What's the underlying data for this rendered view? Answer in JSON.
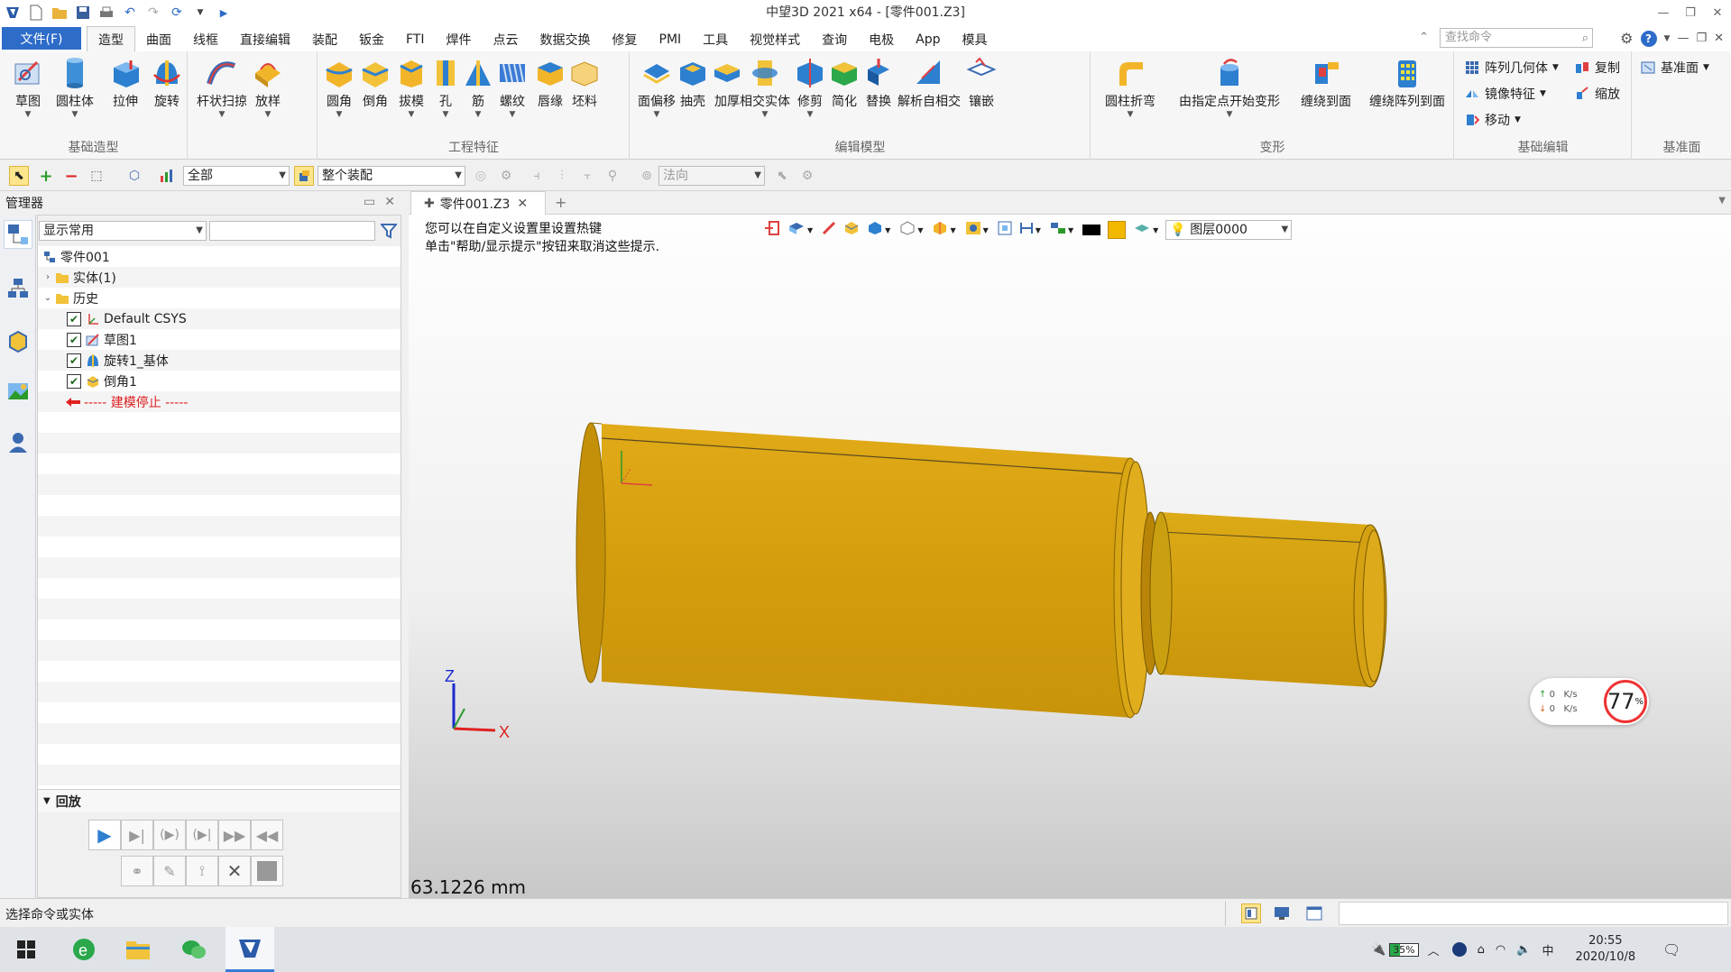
{
  "window": {
    "title": "中望3D 2021 x64 - [零件001.Z3]"
  },
  "menu": {
    "file": "文件(F)",
    "tabs": [
      "造型",
      "曲面",
      "线框",
      "直接编辑",
      "装配",
      "钣金",
      "FTI",
      "焊件",
      "点云",
      "数据交换",
      "修复",
      "PMI",
      "工具",
      "视觉样式",
      "查询",
      "电极",
      "App",
      "模具"
    ],
    "active_index": 0,
    "search_placeholder": "查找命令"
  },
  "ribbon": {
    "groups": [
      {
        "label": "基础造型",
        "buttons": [
          "草图",
          "圆柱体",
          "拉伸",
          "旋转",
          "杆状扫掠",
          "放样"
        ]
      },
      {
        "label": "工程特征",
        "buttons": [
          "圆角",
          "倒角",
          "拔模",
          "孔",
          "筋",
          "螺纹",
          "唇缘",
          "坯料"
        ]
      },
      {
        "label": "编辑模型",
        "buttons": [
          "面偏移",
          "抽壳",
          "加厚",
          "相交实体",
          "修剪",
          "简化",
          "替换",
          "解析自相交",
          "镶嵌"
        ]
      },
      {
        "label": "变形",
        "buttons": [
          "圆柱折弯",
          "由指定点开始变形",
          "缠绕到面",
          "缠绕阵列到面"
        ]
      },
      {
        "label": "基础编辑",
        "buttons": [
          "阵列几何体",
          "镜像特征",
          "移动",
          "复制",
          "缩放"
        ]
      },
      {
        "label": "基准面",
        "buttons": [
          "基准面"
        ]
      }
    ]
  },
  "toolbar": {
    "filter_value": "全部",
    "scope_value": "整个装配",
    "direction_value": "法向"
  },
  "manager": {
    "title": "管理器",
    "display_filter": "显示常用",
    "search_value": ""
  },
  "tree": {
    "root": "零件001",
    "solids": "实体(1)",
    "history": "历史",
    "items": [
      "Default CSYS",
      "草图1",
      "旋转1_基体",
      "倒角1"
    ],
    "stop": "----- 建模停止 -----"
  },
  "playback": {
    "title": "回放"
  },
  "document": {
    "tab": "零件001.Z3"
  },
  "viewport": {
    "hint1": "您可以在自定义设置里设置热键",
    "hint2": "单击\"帮助/显示提示\"按钮来取消这些提示.",
    "layer": "图层0000",
    "distance": "63.1226 mm",
    "axis_z": "Z",
    "axis_x": "X",
    "model_color": "#d9a30c"
  },
  "net": {
    "up": "0",
    "down": "0",
    "unit": "K/s",
    "percent": "77",
    "percent_sign": "%"
  },
  "status": {
    "text": "选择命令或实体"
  },
  "taskbar": {
    "battery": "35%",
    "time": "20:55",
    "date": "2020/10/8"
  }
}
